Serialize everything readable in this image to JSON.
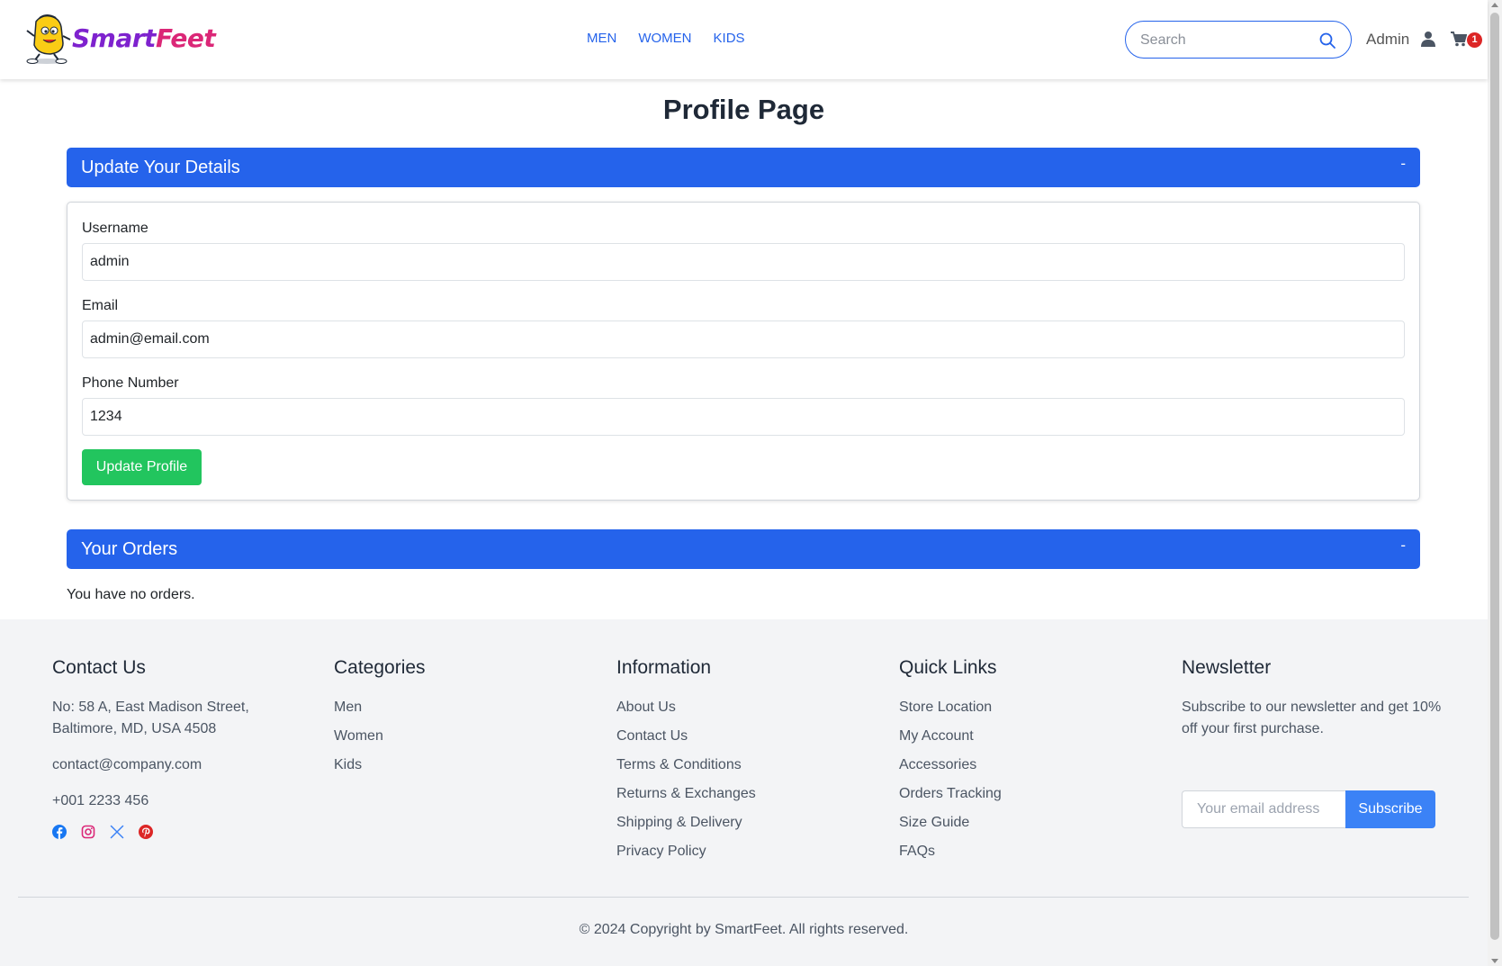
{
  "header": {
    "logo": {
      "part1": "Smart",
      "part2": "Feet"
    },
    "nav": [
      {
        "label": "MEN"
      },
      {
        "label": "WOMEN"
      },
      {
        "label": "KIDS"
      }
    ],
    "search": {
      "placeholder": "Search",
      "value": ""
    },
    "user_label": "Admin",
    "cart_count": "1"
  },
  "main": {
    "title": "Profile Page",
    "details": {
      "section_title": "Update Your Details",
      "toggle": "-",
      "fields": [
        {
          "label": "Username",
          "value": "admin"
        },
        {
          "label": "Email",
          "value": "admin@email.com"
        },
        {
          "label": "Phone Number",
          "value": "1234"
        }
      ],
      "submit_label": "Update Profile"
    },
    "orders": {
      "section_title": "Your Orders",
      "toggle": "-",
      "empty_message": "You have no orders."
    }
  },
  "footer": {
    "contact": {
      "title": "Contact Us",
      "address_line1": "No: 58 A, East Madison Street,",
      "address_line2": "Baltimore, MD, USA 4508",
      "email": "contact@company.com",
      "phone": "+001 2233 456",
      "socials": [
        "facebook-icon",
        "instagram-icon",
        "x-twitter-icon",
        "pinterest-icon"
      ]
    },
    "categories": {
      "title": "Categories",
      "links": [
        "Men",
        "Women",
        "Kids"
      ]
    },
    "information": {
      "title": "Information",
      "links": [
        "About Us",
        "Contact Us",
        "Terms & Conditions",
        "Returns & Exchanges",
        "Shipping & Delivery",
        "Privacy Policy"
      ]
    },
    "quick_links": {
      "title": "Quick Links",
      "links": [
        "Store Location",
        "My Account",
        "Accessories",
        "Orders Tracking",
        "Size Guide",
        "FAQs"
      ]
    },
    "newsletter": {
      "title": "Newsletter",
      "text": "Subscribe to our newsletter and get 10% off your first purchase.",
      "placeholder": "Your email address",
      "button": "Subscribe"
    },
    "copyright": "© 2024 Copyright by SmartFeet. All rights reserved."
  },
  "colors": {
    "primary": "#2563eb",
    "success": "#22c55e",
    "badge": "#dc2626",
    "footer_bg": "#f3f4f6",
    "logo_purple": "#7e22ce",
    "logo_pink": "#db2777"
  }
}
